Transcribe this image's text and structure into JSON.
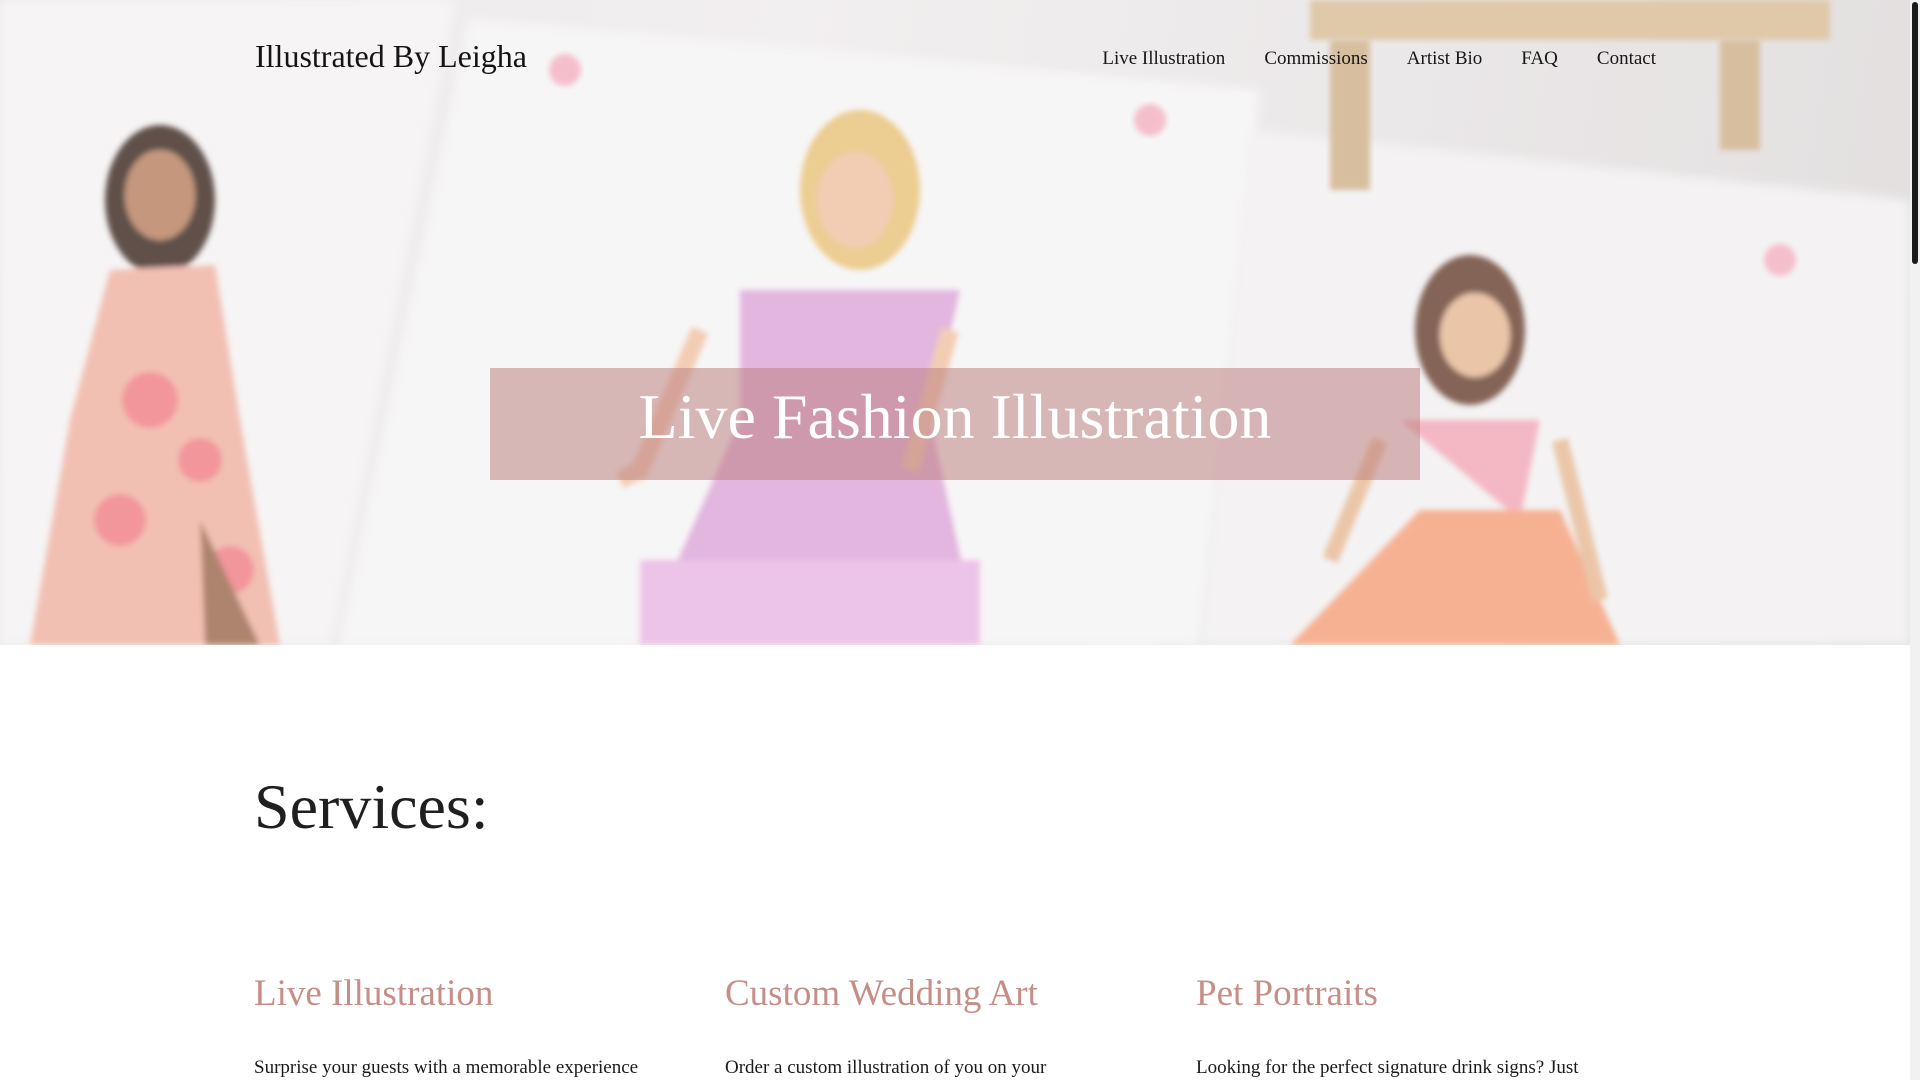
{
  "header": {
    "site_title": "Illustrated By Leigha",
    "nav": [
      {
        "label": "Live Illustration"
      },
      {
        "label": "Commissions"
      },
      {
        "label": "Artist Bio"
      },
      {
        "label": "FAQ"
      },
      {
        "label": "Contact"
      }
    ]
  },
  "hero": {
    "heading": "Live Fashion Illustration",
    "banner_color": "#be8282"
  },
  "services": {
    "title": "Services:",
    "items": [
      {
        "title": "Live Illustration",
        "desc": "Surprise your guests with a memorable experience"
      },
      {
        "title": "Custom Wedding Art",
        "desc": "Order a custom illustration of you on your"
      },
      {
        "title": "Pet Portraits",
        "desc": "Looking for the perfect signature drink signs? Just"
      }
    ]
  },
  "colors": {
    "accent": "#c58e86",
    "text": "#1a1a1a"
  }
}
